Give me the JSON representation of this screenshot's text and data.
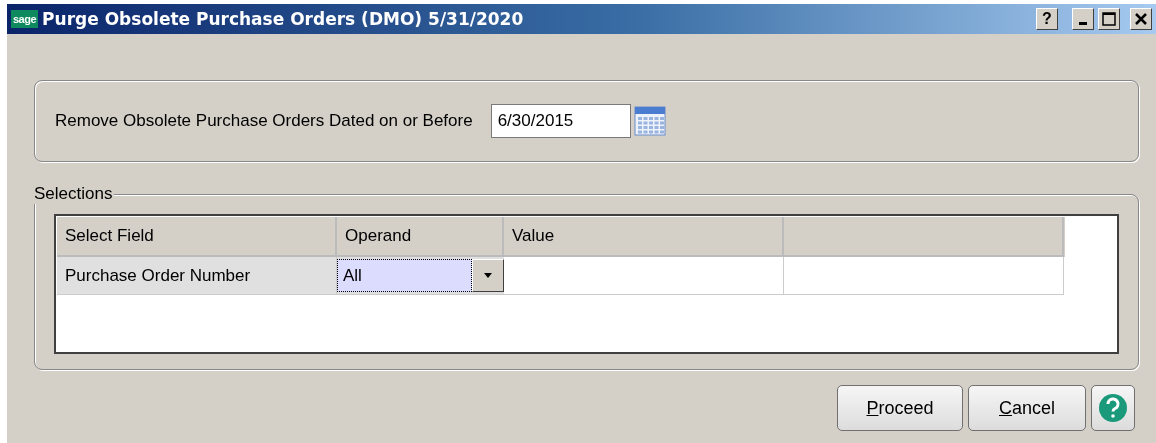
{
  "window": {
    "logo": "sage",
    "title": "Purge Obsolete Purchase Orders (DMO) 5/31/2020",
    "help_glyph": "?"
  },
  "date_filter": {
    "label": "Remove Obsolete Purchase Orders Dated on or Before",
    "value": "6/30/2015"
  },
  "selections": {
    "title": "Selections",
    "columns": [
      "Select Field",
      "Operand",
      "Value"
    ],
    "rows": [
      {
        "field": "Purchase Order Number",
        "operand": "All",
        "value": "",
        "focused": true
      }
    ]
  },
  "buttons": [
    {
      "key": "P",
      "rest": "roceed"
    },
    {
      "key": "C",
      "rest": "ancel"
    }
  ]
}
